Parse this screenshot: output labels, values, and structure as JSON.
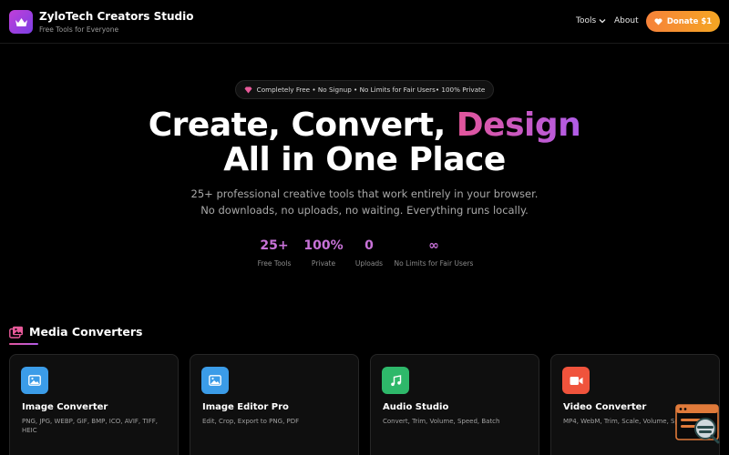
{
  "header": {
    "brand_title": "ZyloTech Creators Studio",
    "brand_subtitle": "Free Tools for Everyone",
    "logo_icon": "crown-icon",
    "nav": {
      "tools": "Tools",
      "about": "About"
    },
    "donate_label": "Donate $1",
    "donate_icon": "heart-icon"
  },
  "hero": {
    "pill_text": "Completely Free • No Signup • No Limits for Fair Users• 100% Private",
    "pill_icon": "gem-icon",
    "title_part1": "Create, Convert, ",
    "title_accent": "Design",
    "title_line2": "All in One Place",
    "description": "25+ professional creative tools that work entirely in your browser. No downloads, no uploads, no waiting. Everything runs locally."
  },
  "stats": [
    {
      "value": "25+",
      "label": "Free Tools"
    },
    {
      "value": "100%",
      "label": "Private"
    },
    {
      "value": "0",
      "label": "Uploads"
    },
    {
      "value": "∞",
      "label": "No Limits for Fair Users"
    }
  ],
  "section": {
    "title": "Media Converters",
    "icon": "images-icon"
  },
  "cards": [
    {
      "title": "Image Converter",
      "description": "PNG, JPG, WEBP, GIF, BMP, ICO, AVIF, TIFF, HEIC",
      "icon": "image-icon",
      "color": "#3b9ce8"
    },
    {
      "title": "Image Editor Pro",
      "description": "Edit, Crop, Export to PNG, PDF",
      "icon": "image-icon",
      "color": "#3b9ce8"
    },
    {
      "title": "Audio Studio",
      "description": "Convert, Trim, Volume, Speed, Batch",
      "icon": "music-icon",
      "color": "#2eb86a"
    },
    {
      "title": "Video Converter",
      "description": "MP4, WebM, Trim, Scale, Volume, Sp",
      "icon": "video-camera-icon",
      "color": "#f0533c"
    }
  ],
  "colors": {
    "accent_pink": "#e3559a",
    "accent_purple": "#b05ce8",
    "stat_color": "#c872d8",
    "donate_orange": "#f6823a"
  }
}
